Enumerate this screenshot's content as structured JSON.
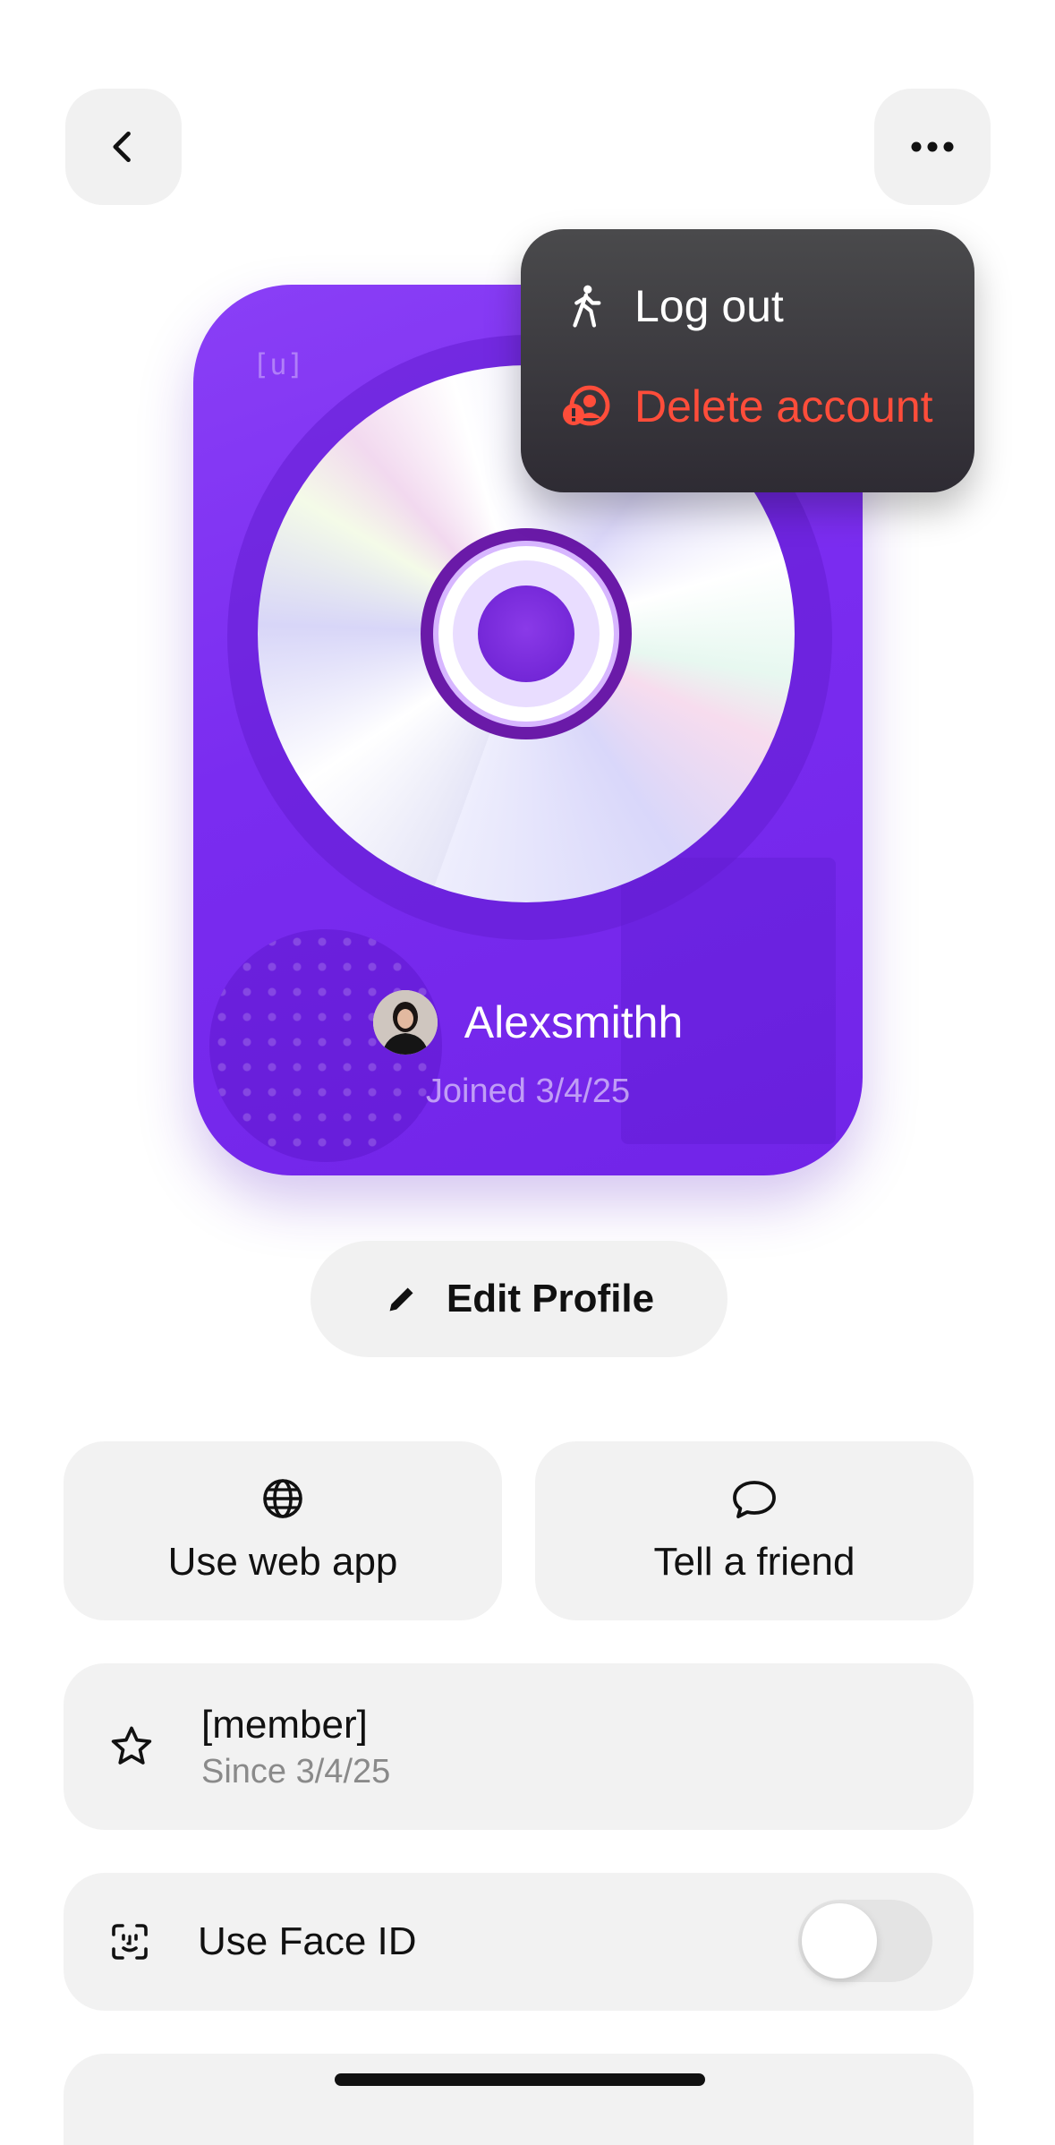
{
  "header": {
    "back_icon": "chevron-left-icon",
    "more_icon": "ellipsis-icon"
  },
  "menu": {
    "items": [
      {
        "label": "Log out",
        "icon": "walking-person-icon",
        "color": "#ffffff"
      },
      {
        "label": "Delete account",
        "icon": "user-alert-icon",
        "color": "#ff4d3a"
      }
    ]
  },
  "card": {
    "tag": "[u]",
    "username": "Alexsmithh",
    "joined": "Joined 3/4/25",
    "color": "#7a2cf0"
  },
  "actions": {
    "edit_profile": "Edit Profile",
    "web_app": "Use web app",
    "tell_friend": "Tell a friend"
  },
  "membership": {
    "title": "[member]",
    "since": "Since 3/4/25"
  },
  "face_id": {
    "label": "Use Face ID",
    "enabled": false
  }
}
